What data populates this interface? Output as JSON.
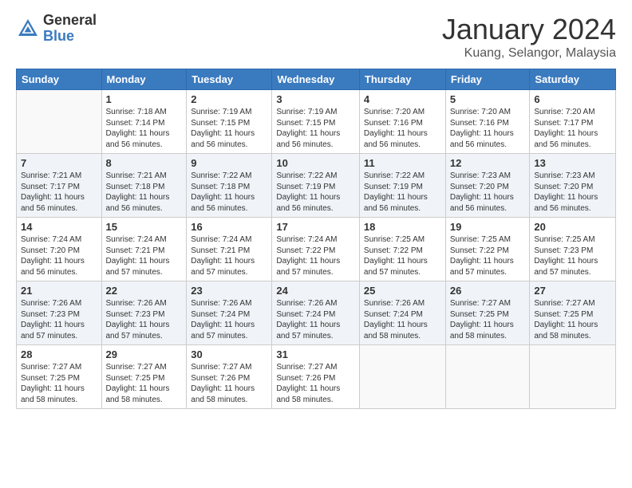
{
  "logo": {
    "general": "General",
    "blue": "Blue"
  },
  "title": "January 2024",
  "location": "Kuang, Selangor, Malaysia",
  "days_of_week": [
    "Sunday",
    "Monday",
    "Tuesday",
    "Wednesday",
    "Thursday",
    "Friday",
    "Saturday"
  ],
  "weeks": [
    [
      {
        "day": "",
        "sunrise": "",
        "sunset": "",
        "daylight": ""
      },
      {
        "day": "1",
        "sunrise": "Sunrise: 7:18 AM",
        "sunset": "Sunset: 7:14 PM",
        "daylight": "Daylight: 11 hours and 56 minutes."
      },
      {
        "day": "2",
        "sunrise": "Sunrise: 7:19 AM",
        "sunset": "Sunset: 7:15 PM",
        "daylight": "Daylight: 11 hours and 56 minutes."
      },
      {
        "day": "3",
        "sunrise": "Sunrise: 7:19 AM",
        "sunset": "Sunset: 7:15 PM",
        "daylight": "Daylight: 11 hours and 56 minutes."
      },
      {
        "day": "4",
        "sunrise": "Sunrise: 7:20 AM",
        "sunset": "Sunset: 7:16 PM",
        "daylight": "Daylight: 11 hours and 56 minutes."
      },
      {
        "day": "5",
        "sunrise": "Sunrise: 7:20 AM",
        "sunset": "Sunset: 7:16 PM",
        "daylight": "Daylight: 11 hours and 56 minutes."
      },
      {
        "day": "6",
        "sunrise": "Sunrise: 7:20 AM",
        "sunset": "Sunset: 7:17 PM",
        "daylight": "Daylight: 11 hours and 56 minutes."
      }
    ],
    [
      {
        "day": "7",
        "sunrise": "Sunrise: 7:21 AM",
        "sunset": "Sunset: 7:17 PM",
        "daylight": "Daylight: 11 hours and 56 minutes."
      },
      {
        "day": "8",
        "sunrise": "Sunrise: 7:21 AM",
        "sunset": "Sunset: 7:18 PM",
        "daylight": "Daylight: 11 hours and 56 minutes."
      },
      {
        "day": "9",
        "sunrise": "Sunrise: 7:22 AM",
        "sunset": "Sunset: 7:18 PM",
        "daylight": "Daylight: 11 hours and 56 minutes."
      },
      {
        "day": "10",
        "sunrise": "Sunrise: 7:22 AM",
        "sunset": "Sunset: 7:19 PM",
        "daylight": "Daylight: 11 hours and 56 minutes."
      },
      {
        "day": "11",
        "sunrise": "Sunrise: 7:22 AM",
        "sunset": "Sunset: 7:19 PM",
        "daylight": "Daylight: 11 hours and 56 minutes."
      },
      {
        "day": "12",
        "sunrise": "Sunrise: 7:23 AM",
        "sunset": "Sunset: 7:20 PM",
        "daylight": "Daylight: 11 hours and 56 minutes."
      },
      {
        "day": "13",
        "sunrise": "Sunrise: 7:23 AM",
        "sunset": "Sunset: 7:20 PM",
        "daylight": "Daylight: 11 hours and 56 minutes."
      }
    ],
    [
      {
        "day": "14",
        "sunrise": "Sunrise: 7:24 AM",
        "sunset": "Sunset: 7:20 PM",
        "daylight": "Daylight: 11 hours and 56 minutes."
      },
      {
        "day": "15",
        "sunrise": "Sunrise: 7:24 AM",
        "sunset": "Sunset: 7:21 PM",
        "daylight": "Daylight: 11 hours and 57 minutes."
      },
      {
        "day": "16",
        "sunrise": "Sunrise: 7:24 AM",
        "sunset": "Sunset: 7:21 PM",
        "daylight": "Daylight: 11 hours and 57 minutes."
      },
      {
        "day": "17",
        "sunrise": "Sunrise: 7:24 AM",
        "sunset": "Sunset: 7:22 PM",
        "daylight": "Daylight: 11 hours and 57 minutes."
      },
      {
        "day": "18",
        "sunrise": "Sunrise: 7:25 AM",
        "sunset": "Sunset: 7:22 PM",
        "daylight": "Daylight: 11 hours and 57 minutes."
      },
      {
        "day": "19",
        "sunrise": "Sunrise: 7:25 AM",
        "sunset": "Sunset: 7:22 PM",
        "daylight": "Daylight: 11 hours and 57 minutes."
      },
      {
        "day": "20",
        "sunrise": "Sunrise: 7:25 AM",
        "sunset": "Sunset: 7:23 PM",
        "daylight": "Daylight: 11 hours and 57 minutes."
      }
    ],
    [
      {
        "day": "21",
        "sunrise": "Sunrise: 7:26 AM",
        "sunset": "Sunset: 7:23 PM",
        "daylight": "Daylight: 11 hours and 57 minutes."
      },
      {
        "day": "22",
        "sunrise": "Sunrise: 7:26 AM",
        "sunset": "Sunset: 7:23 PM",
        "daylight": "Daylight: 11 hours and 57 minutes."
      },
      {
        "day": "23",
        "sunrise": "Sunrise: 7:26 AM",
        "sunset": "Sunset: 7:24 PM",
        "daylight": "Daylight: 11 hours and 57 minutes."
      },
      {
        "day": "24",
        "sunrise": "Sunrise: 7:26 AM",
        "sunset": "Sunset: 7:24 PM",
        "daylight": "Daylight: 11 hours and 57 minutes."
      },
      {
        "day": "25",
        "sunrise": "Sunrise: 7:26 AM",
        "sunset": "Sunset: 7:24 PM",
        "daylight": "Daylight: 11 hours and 58 minutes."
      },
      {
        "day": "26",
        "sunrise": "Sunrise: 7:27 AM",
        "sunset": "Sunset: 7:25 PM",
        "daylight": "Daylight: 11 hours and 58 minutes."
      },
      {
        "day": "27",
        "sunrise": "Sunrise: 7:27 AM",
        "sunset": "Sunset: 7:25 PM",
        "daylight": "Daylight: 11 hours and 58 minutes."
      }
    ],
    [
      {
        "day": "28",
        "sunrise": "Sunrise: 7:27 AM",
        "sunset": "Sunset: 7:25 PM",
        "daylight": "Daylight: 11 hours and 58 minutes."
      },
      {
        "day": "29",
        "sunrise": "Sunrise: 7:27 AM",
        "sunset": "Sunset: 7:25 PM",
        "daylight": "Daylight: 11 hours and 58 minutes."
      },
      {
        "day": "30",
        "sunrise": "Sunrise: 7:27 AM",
        "sunset": "Sunset: 7:26 PM",
        "daylight": "Daylight: 11 hours and 58 minutes."
      },
      {
        "day": "31",
        "sunrise": "Sunrise: 7:27 AM",
        "sunset": "Sunset: 7:26 PM",
        "daylight": "Daylight: 11 hours and 58 minutes."
      },
      {
        "day": "",
        "sunrise": "",
        "sunset": "",
        "daylight": ""
      },
      {
        "day": "",
        "sunrise": "",
        "sunset": "",
        "daylight": ""
      },
      {
        "day": "",
        "sunrise": "",
        "sunset": "",
        "daylight": ""
      }
    ]
  ]
}
